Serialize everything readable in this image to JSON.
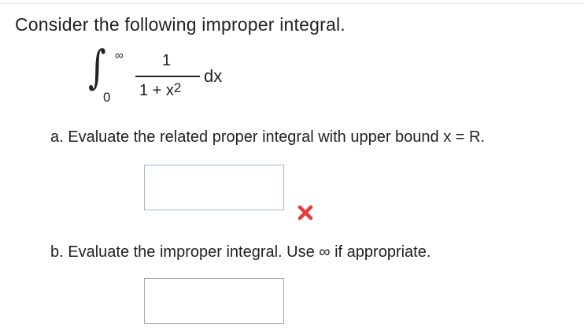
{
  "question": {
    "intro": "Consider the following improper integral.",
    "integral": {
      "sign": "∫",
      "upper_limit": "∞",
      "lower_limit": "0",
      "numerator": "1",
      "denominator_base": "1 + x",
      "denominator_exponent": "2",
      "differential": "dx"
    }
  },
  "part_a": {
    "label": "a. Evaluate the related proper integral with upper bound x = R.",
    "answer_value": "",
    "status_icon": "red-x-incorrect-icon",
    "status_color": "#e8393b"
  },
  "part_b": {
    "label": "b. Evaluate the improper integral. Use ∞ if appropriate.",
    "answer_value": ""
  }
}
